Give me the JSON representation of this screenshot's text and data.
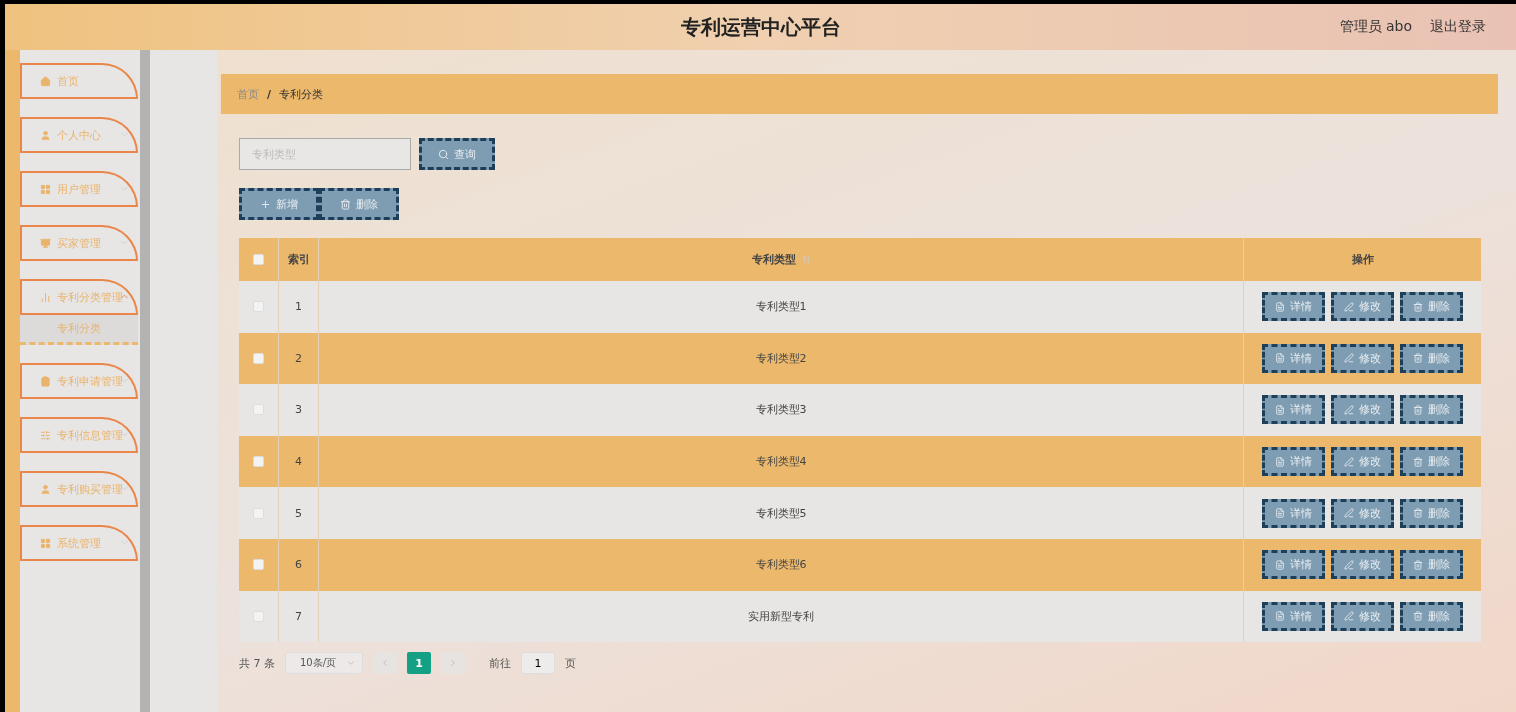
{
  "header": {
    "title": "专利运营中心平台",
    "user": "管理员 abo",
    "logout": "退出登录"
  },
  "sidebar": {
    "items": [
      {
        "label": "首页",
        "kind": "link"
      },
      {
        "label": "个人中心",
        "kind": "menu",
        "expanded": false
      },
      {
        "label": "用户管理",
        "kind": "menu",
        "expanded": false
      },
      {
        "label": "买家管理",
        "kind": "menu",
        "expanded": false
      },
      {
        "label": "专利分类管理",
        "kind": "menu",
        "expanded": true,
        "children": [
          {
            "label": "专利分类",
            "selected": true
          }
        ]
      },
      {
        "label": "专利申请管理",
        "kind": "menu",
        "expanded": false
      },
      {
        "label": "专利信息管理",
        "kind": "menu",
        "expanded": false
      },
      {
        "label": "专利购买管理",
        "kind": "menu",
        "expanded": false
      },
      {
        "label": "系统管理",
        "kind": "menu",
        "expanded": false
      }
    ]
  },
  "breadcrumb": {
    "items": [
      "首页",
      "专利分类"
    ],
    "separator": "/"
  },
  "search": {
    "placeholder": "专利类型",
    "button": "查询"
  },
  "actions": [
    "新增",
    "删除"
  ],
  "table": {
    "columns": [
      "索引",
      "专利类型",
      "操作"
    ],
    "select_all_checked": false,
    "rows": [
      {
        "index": "1",
        "type": "专利类型1",
        "checked": false,
        "buttons": [
          "详情",
          "修改",
          "删除"
        ]
      },
      {
        "index": "2",
        "type": "专利类型2",
        "checked": false,
        "buttons": [
          "详情",
          "修改",
          "删除"
        ]
      },
      {
        "index": "3",
        "type": "专利类型3",
        "checked": false,
        "buttons": [
          "详情",
          "修改",
          "删除"
        ]
      },
      {
        "index": "4",
        "type": "专利类型4",
        "checked": false,
        "buttons": [
          "详情",
          "修改",
          "删除"
        ]
      },
      {
        "index": "5",
        "type": "专利类型5",
        "checked": false,
        "buttons": [
          "详情",
          "修改",
          "删除"
        ]
      },
      {
        "index": "6",
        "type": "专利类型6",
        "checked": false,
        "buttons": [
          "详情",
          "修改",
          "删除"
        ]
      },
      {
        "index": "7",
        "type": "实用新型专利",
        "checked": false,
        "buttons": [
          "详情",
          "修改",
          "删除"
        ]
      }
    ]
  },
  "pagination": {
    "total": "共 7 条",
    "page_size": "10条/页",
    "pages": [
      {
        "label": "1",
        "selected": true
      }
    ],
    "goto_label": "前往",
    "goto_value": "1",
    "page_unit": "页"
  }
}
